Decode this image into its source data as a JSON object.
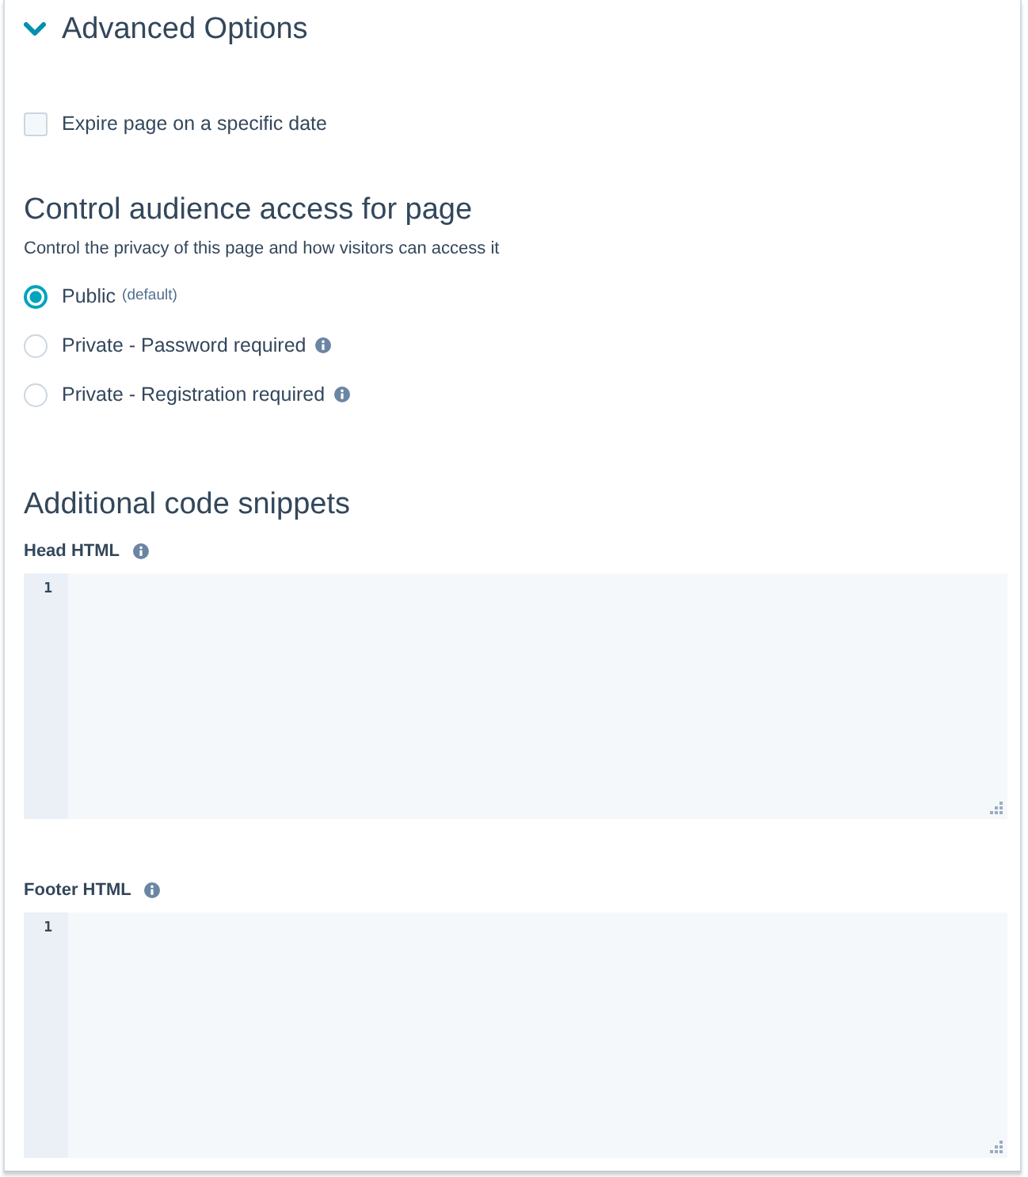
{
  "section": {
    "title": "Advanced Options",
    "expanded": true
  },
  "expire_option": {
    "label": "Expire page on a specific date",
    "checked": false
  },
  "audience": {
    "heading": "Control audience access for page",
    "description": "Control the privacy of this page and how visitors can access it",
    "options": [
      {
        "label": "Public",
        "note": "(default)",
        "info": false,
        "selected": true
      },
      {
        "label": "Private - Password required",
        "info": true,
        "selected": false
      },
      {
        "label": "Private - Registration required",
        "info": true,
        "selected": false
      }
    ]
  },
  "snippets": {
    "heading": "Additional code snippets",
    "editors": [
      {
        "label": "Head HTML",
        "line_numbers": [
          "1"
        ]
      },
      {
        "label": "Footer HTML",
        "line_numbers": [
          "1"
        ]
      }
    ]
  }
}
